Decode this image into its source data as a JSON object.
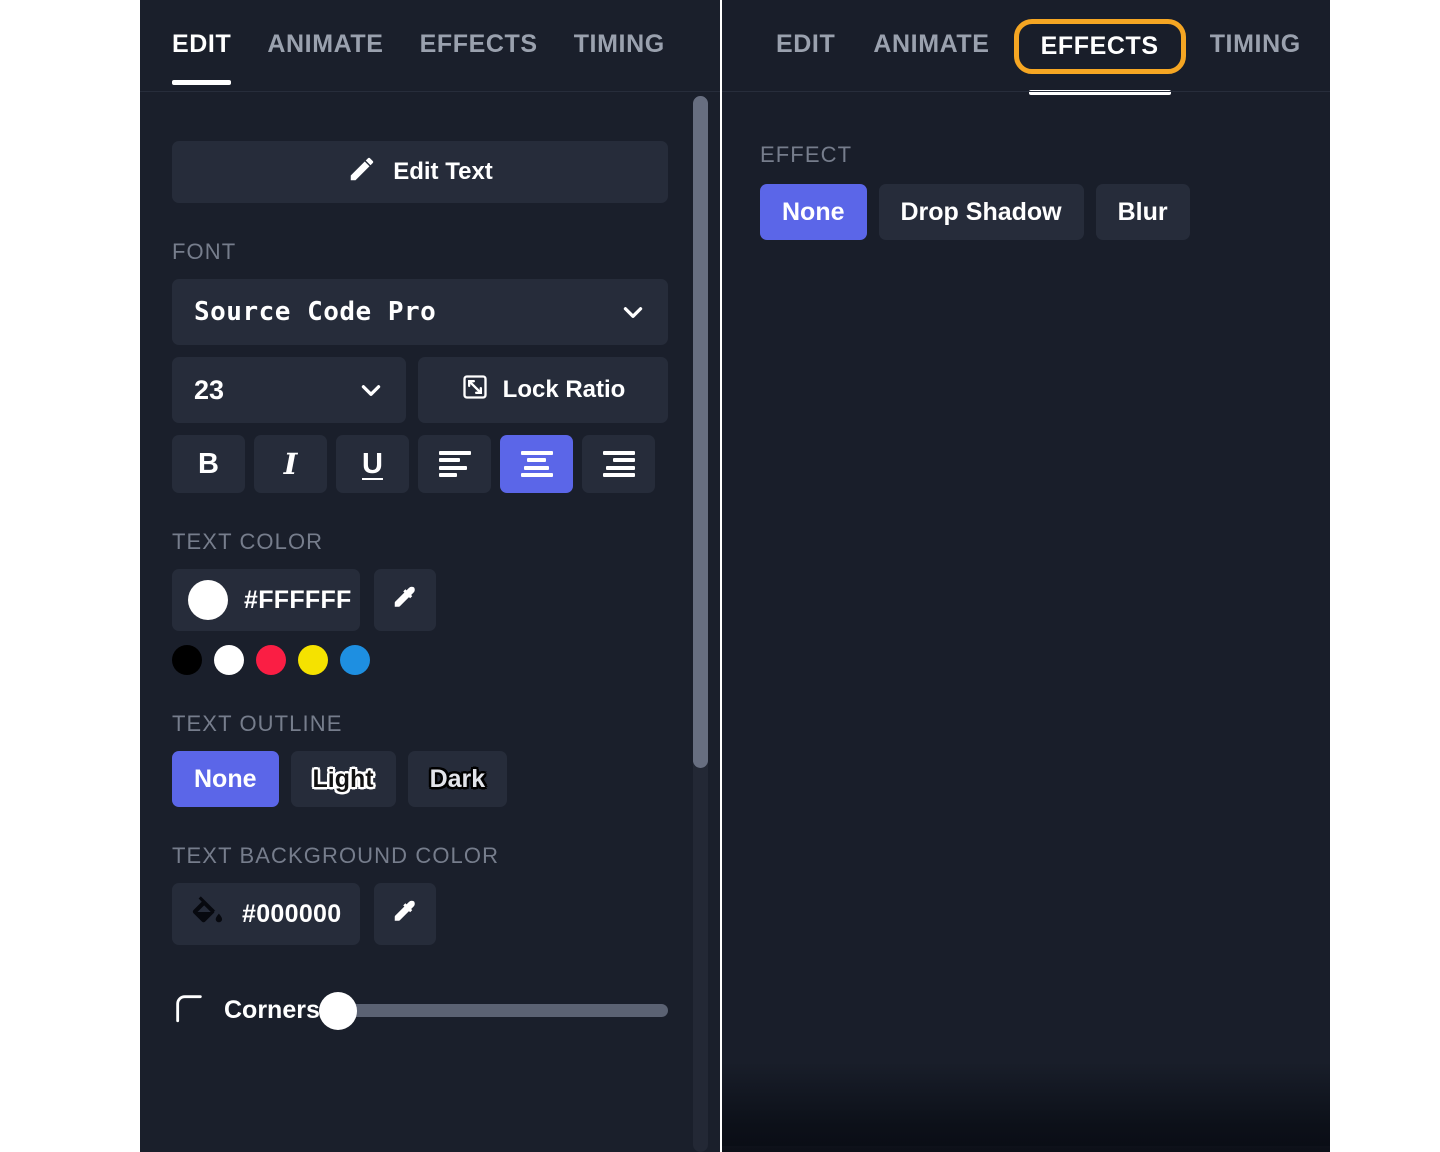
{
  "colors": {
    "accent": "#5B66E8",
    "panel_bg": "#1A1F2B",
    "control_bg": "#262C3A",
    "label": "#767D8C",
    "highlight_ring": "#F5A623"
  },
  "left_panel": {
    "tabs": [
      {
        "label": "EDIT",
        "active": true
      },
      {
        "label": "ANIMATE",
        "active": false
      },
      {
        "label": "EFFECTS",
        "active": false
      },
      {
        "label": "TIMING",
        "active": false
      }
    ],
    "edit_text_button": "Edit Text",
    "font": {
      "section_label": "FONT",
      "family": "Source Code Pro",
      "size": "23",
      "lock_ratio_label": "Lock Ratio",
      "format_buttons": [
        {
          "name": "bold",
          "glyph": "B",
          "active": false
        },
        {
          "name": "italic",
          "glyph": "I",
          "active": false
        },
        {
          "name": "underline",
          "glyph": "U",
          "active": false
        },
        {
          "name": "align-left",
          "glyph": "",
          "active": false
        },
        {
          "name": "align-center",
          "glyph": "",
          "active": true
        },
        {
          "name": "align-right",
          "glyph": "",
          "active": false
        }
      ]
    },
    "text_color": {
      "section_label": "TEXT COLOR",
      "value": "#FFFFFF",
      "swatch": "#FFFFFF",
      "presets": [
        "#000000",
        "#FFFFFF",
        "#FA1E44",
        "#F5E200",
        "#1E8FE1"
      ]
    },
    "text_outline": {
      "section_label": "TEXT OUTLINE",
      "options": [
        {
          "label": "None",
          "active": true,
          "style": "plain"
        },
        {
          "label": "Light",
          "active": false,
          "style": "light"
        },
        {
          "label": "Dark",
          "active": false,
          "style": "dark"
        }
      ]
    },
    "text_background_color": {
      "section_label": "TEXT BACKGROUND COLOR",
      "value": "#000000",
      "swatch": "#000000"
    },
    "corners": {
      "label": "Corners",
      "value": 0
    }
  },
  "right_panel": {
    "tabs": [
      {
        "label": "EDIT",
        "active": false,
        "annotated": false
      },
      {
        "label": "ANIMATE",
        "active": false,
        "annotated": false
      },
      {
        "label": "EFFECTS",
        "active": true,
        "annotated": true
      },
      {
        "label": "TIMING",
        "active": false,
        "annotated": false
      }
    ],
    "effect": {
      "section_label": "EFFECT",
      "options": [
        {
          "label": "None",
          "active": true
        },
        {
          "label": "Drop Shadow",
          "active": false
        },
        {
          "label": "Blur",
          "active": false
        }
      ]
    }
  }
}
